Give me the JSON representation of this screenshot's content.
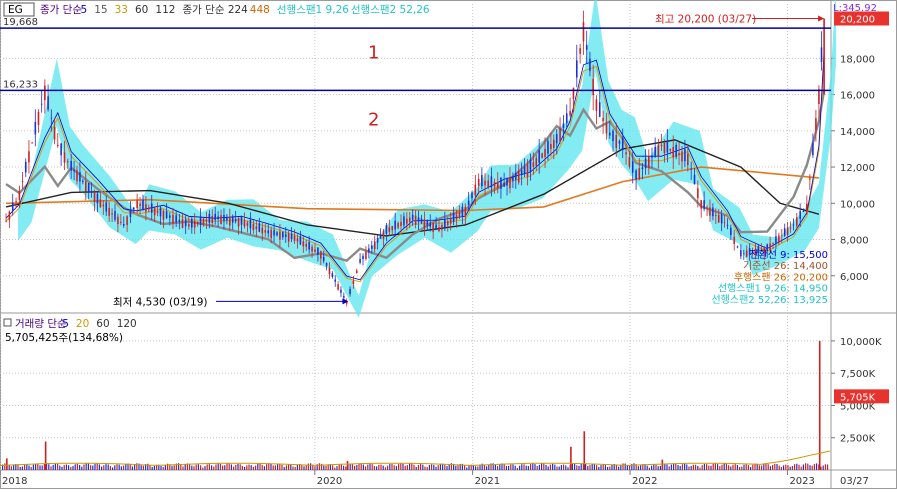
{
  "chart_data": [
    {
      "type": "candlestick",
      "panel": "price",
      "symbol_box": "EG",
      "legend": [
        {
          "text": "종가 단순",
          "color": "#4b0082"
        },
        {
          "text": "5",
          "color": "#0000cc"
        },
        {
          "text": "15",
          "color": "#555555"
        },
        {
          "text": "33",
          "color": "#cc9900"
        },
        {
          "text": "60",
          "color": "#333333"
        },
        {
          "text": "112",
          "color": "#333333"
        },
        {
          "text": "종가 단순 224",
          "color": "#333333"
        },
        {
          "text": "448",
          "color": "#cc6600"
        },
        {
          "text": "선행스팬1 9,26",
          "color": "#22c4c4"
        },
        {
          "text": "선행스팬2 52,26",
          "color": "#22c4c4"
        }
      ],
      "top_right_label": "L:345.92",
      "ylim": [
        4000,
        21000
      ],
      "y_ticks": [
        {
          "value": 6000,
          "label": "6,000"
        },
        {
          "value": 8000,
          "label": "8,000"
        },
        {
          "value": 10000,
          "label": "10,000"
        },
        {
          "value": 12000,
          "label": "12,000"
        },
        {
          "value": 14000,
          "label": "14,000"
        },
        {
          "value": 16000,
          "label": "16,000"
        },
        {
          "value": 18000,
          "label": "18,000"
        }
      ],
      "current_price": {
        "value": 20200,
        "label": "20,200"
      },
      "horizontal_lines": [
        {
          "value": 19668,
          "label": "19,668",
          "color": "#0000aa"
        },
        {
          "value": 16233,
          "label": "16,233",
          "color": "#0000aa"
        }
      ],
      "zone_labels": [
        {
          "text": "1",
          "value": 18000
        },
        {
          "text": "2",
          "value": 14300
        }
      ],
      "annotations": {
        "high": {
          "text": "최고 20,200 (03/27)",
          "value": 20200
        },
        "low": {
          "text": "최저 4,530 (03/19)",
          "value": 4530
        }
      },
      "ichimoku_readout": [
        {
          "text": "전환선 9: 15,500",
          "color": "#0000cc"
        },
        {
          "text": "기준선 26: 14,400",
          "color": "#a0522d"
        },
        {
          "text": "후행스팬 26: 20,200",
          "color": "#cc6600"
        },
        {
          "text": "선행스팬1 9,26: 14,950",
          "color": "#22c4c4"
        },
        {
          "text": "선행스팬2 52,26: 13,925",
          "color": "#22c4c4"
        }
      ],
      "price_series": [
        {
          "date": "2018-01",
          "value": 9000
        },
        {
          "date": "2018-02",
          "value": 10500
        },
        {
          "date": "2018-04",
          "value": 16200
        },
        {
          "date": "2018-05",
          "value": 13200
        },
        {
          "date": "2018-06",
          "value": 12000
        },
        {
          "date": "2018-08",
          "value": 10200
        },
        {
          "date": "2018-10",
          "value": 8800
        },
        {
          "date": "2018-11",
          "value": 10000
        },
        {
          "date": "2019-01",
          "value": 9400
        },
        {
          "date": "2019-03",
          "value": 8800
        },
        {
          "date": "2019-05",
          "value": 9200
        },
        {
          "date": "2019-07",
          "value": 9000
        },
        {
          "date": "2019-09",
          "value": 8400
        },
        {
          "date": "2019-11",
          "value": 8100
        },
        {
          "date": "2020-01",
          "value": 7200
        },
        {
          "date": "2020-03",
          "value": 4530
        },
        {
          "date": "2020-04",
          "value": 6800
        },
        {
          "date": "2020-06",
          "value": 8500
        },
        {
          "date": "2020-08",
          "value": 9200
        },
        {
          "date": "2020-10",
          "value": 8600
        },
        {
          "date": "2020-12",
          "value": 9600
        },
        {
          "date": "2021-01",
          "value": 11200
        },
        {
          "date": "2021-03",
          "value": 11000
        },
        {
          "date": "2021-05",
          "value": 12000
        },
        {
          "date": "2021-07",
          "value": 13500
        },
        {
          "date": "2021-08",
          "value": 15000
        },
        {
          "date": "2021-09",
          "value": 19600
        },
        {
          "date": "2021-10",
          "value": 15500
        },
        {
          "date": "2021-11",
          "value": 13800
        },
        {
          "date": "2021-12",
          "value": 13200
        },
        {
          "date": "2022-01",
          "value": 11500
        },
        {
          "date": "2022-03",
          "value": 13200
        },
        {
          "date": "2022-05",
          "value": 12500
        },
        {
          "date": "2022-06",
          "value": 10000
        },
        {
          "date": "2022-08",
          "value": 8800
        },
        {
          "date": "2022-09",
          "value": 7200
        },
        {
          "date": "2022-11",
          "value": 7500
        },
        {
          "date": "2023-01",
          "value": 8800
        },
        {
          "date": "2023-02",
          "value": 9800
        },
        {
          "date": "2023-03",
          "value": 16000
        },
        {
          "date": "2023-03-27",
          "value": 20200
        }
      ],
      "ma_long_224": [
        {
          "date": "2018-01",
          "value": 9800
        },
        {
          "date": "2018-06",
          "value": 10600
        },
        {
          "date": "2018-12",
          "value": 10700
        },
        {
          "date": "2019-06",
          "value": 10000
        },
        {
          "date": "2019-12",
          "value": 8800
        },
        {
          "date": "2020-06",
          "value": 8200
        },
        {
          "date": "2020-12",
          "value": 8800
        },
        {
          "date": "2021-06",
          "value": 10500
        },
        {
          "date": "2021-12",
          "value": 13000
        },
        {
          "date": "2022-04",
          "value": 13500
        },
        {
          "date": "2022-09",
          "value": 12000
        },
        {
          "date": "2022-12",
          "value": 10000
        },
        {
          "date": "2023-03",
          "value": 9400
        }
      ],
      "ma_long_448": [
        {
          "date": "2018-01",
          "value": 10000
        },
        {
          "date": "2018-12",
          "value": 10200
        },
        {
          "date": "2019-12",
          "value": 9700
        },
        {
          "date": "2020-12",
          "value": 9600
        },
        {
          "date": "2021-06",
          "value": 9800
        },
        {
          "date": "2021-12",
          "value": 11200
        },
        {
          "date": "2022-06",
          "value": 12000
        },
        {
          "date": "2022-12",
          "value": 11600
        },
        {
          "date": "2023-03",
          "value": 11400
        }
      ],
      "x_ticks": [
        "2018",
        "2020",
        "2021",
        "2022",
        "2023"
      ],
      "x_end_label": "03/27"
    },
    {
      "type": "bar",
      "panel": "volume",
      "legend": [
        {
          "text": "거래량 단순",
          "color": "#4b0082"
        },
        {
          "text": "5",
          "color": "#0000cc"
        },
        {
          "text": "20",
          "color": "#cc9900"
        },
        {
          "text": "60",
          "color": "#333333"
        },
        {
          "text": "120",
          "color": "#333333"
        }
      ],
      "readout": "5,705,425주(134,68%)",
      "ylim": [
        0,
        11000
      ],
      "y_unit": "K",
      "y_ticks": [
        {
          "value": 2500,
          "label": "2,500K"
        },
        {
          "value": 5000,
          "label": "5,000K"
        },
        {
          "value": 7500,
          "label": "7,500K"
        },
        {
          "value": 10000,
          "label": "10,000K"
        }
      ],
      "current_volume": {
        "value": 5705,
        "label": "5,705K"
      },
      "volume_spikes": [
        {
          "date": "2018-01",
          "value": 900
        },
        {
          "date": "2018-04",
          "value": 2200
        },
        {
          "date": "2020-03",
          "value": 700
        },
        {
          "date": "2021-08",
          "value": 1800
        },
        {
          "date": "2021-09",
          "value": 3000
        },
        {
          "date": "2022-03",
          "value": 800
        },
        {
          "date": "2023-03",
          "value": 10000
        }
      ]
    }
  ]
}
